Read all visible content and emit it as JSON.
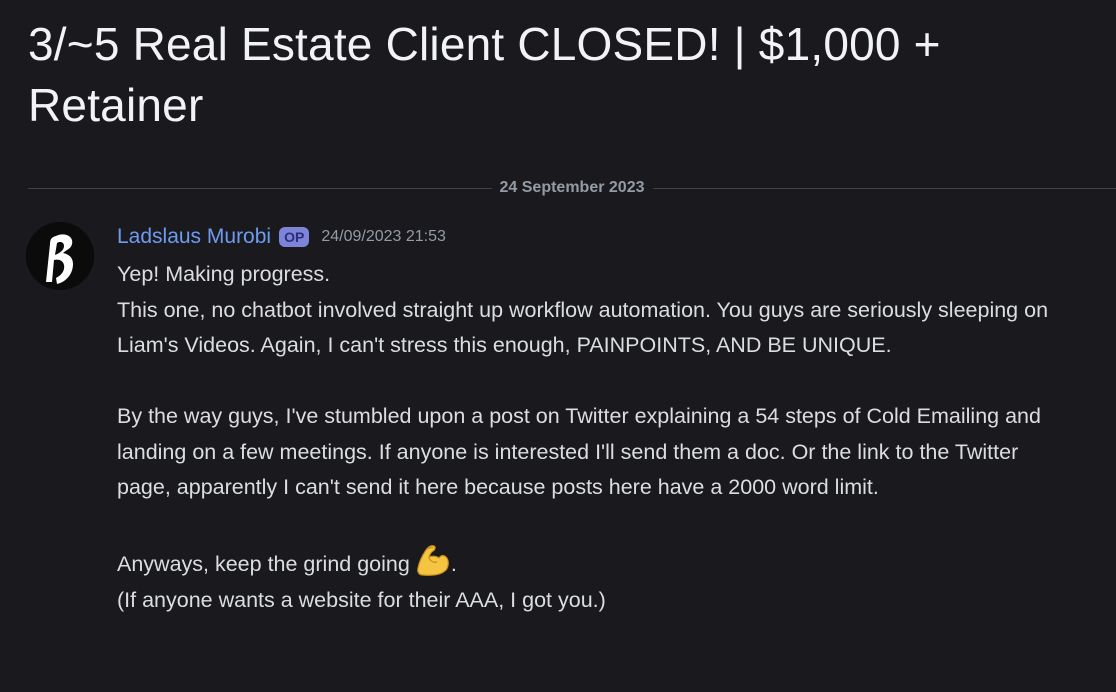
{
  "thread": {
    "title": "3/~5 Real Estate Client CLOSED! | $1,000 + Retainer"
  },
  "divider": {
    "date": "24 September 2023"
  },
  "message": {
    "author": "Ladslaus Murobi",
    "badge": "OP",
    "timestamp": "24/09/2023 21:53",
    "avatar_icon": "logo-icon",
    "lines": [
      "Yep! Making progress.",
      "This one, no chatbot involved straight up workflow automation. You guys are seriously sleeping on Liam's Videos. Again, I can't stress this enough, PAINPOINTS, AND BE UNIQUE.",
      "By the way guys, I've stumbled upon a post on Twitter explaining a 54 steps of Cold Emailing and landing on a few meetings. If anyone is interested I'll send them a doc. Or the link to the Twitter page, apparently I can't send it here because posts here have a 2000 word limit.",
      "Anyways, keep the grind going",
      ".",
      "(If anyone wants a website for their AAA, I got you.)"
    ],
    "emoji": "flexed-biceps-icon"
  },
  "colors": {
    "background": "#1a1a1e",
    "author": "#6e9bf0",
    "badge_bg": "#7c85d8",
    "text": "#dbdee1",
    "muted": "#949ba4"
  }
}
